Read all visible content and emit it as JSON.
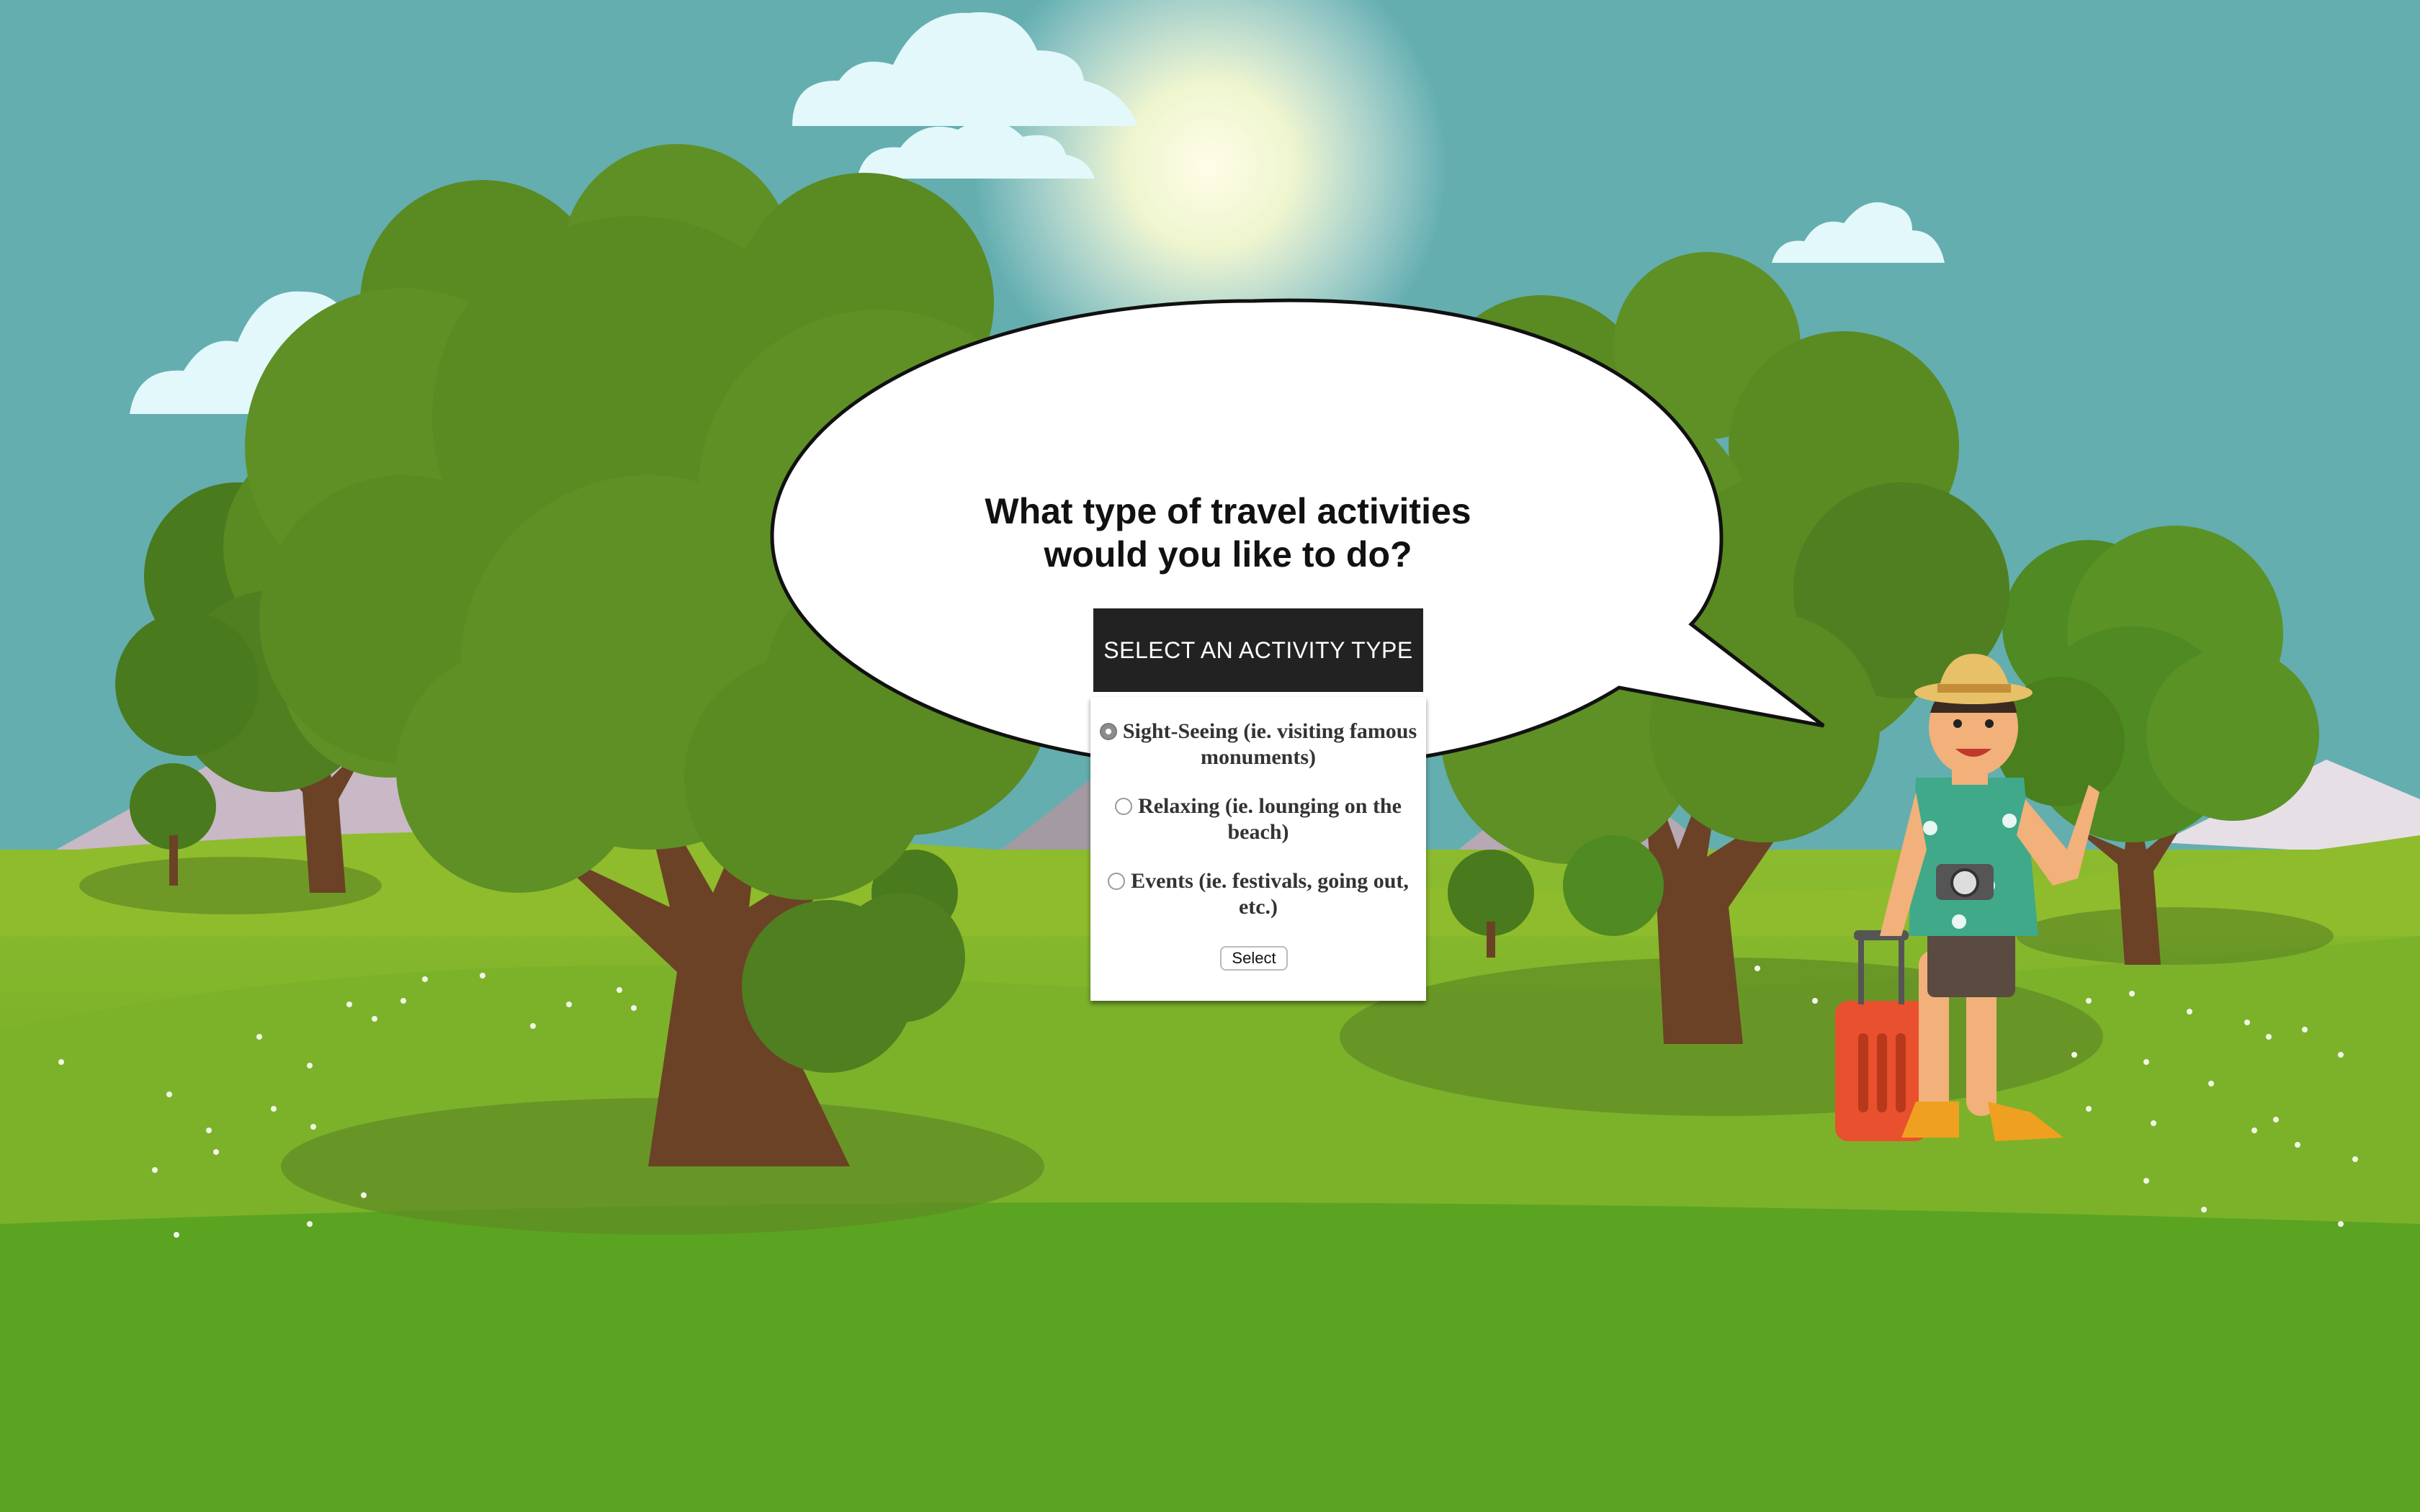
{
  "prompt": {
    "line1": "What type of travel activities",
    "line2": "would you like to do?"
  },
  "panel": {
    "header": "SELECT AN ACTIVITY TYPE",
    "options": [
      {
        "label": "Sight-Seeing (ie. visiting famous monuments)",
        "selected": true
      },
      {
        "label": "Relaxing (ie. lounging on the beach)",
        "selected": false
      },
      {
        "label": "Events (ie. festivals, going out, etc.)",
        "selected": false
      }
    ],
    "button_label": "Select"
  },
  "colors": {
    "sky": "#64aeb0",
    "grass": "#7bb02a",
    "grass_dark": "#55a020",
    "tree": "#5e8e24",
    "trunk": "#6b4226",
    "panel_header_bg": "#222222",
    "suitcase": "#e8502e"
  }
}
